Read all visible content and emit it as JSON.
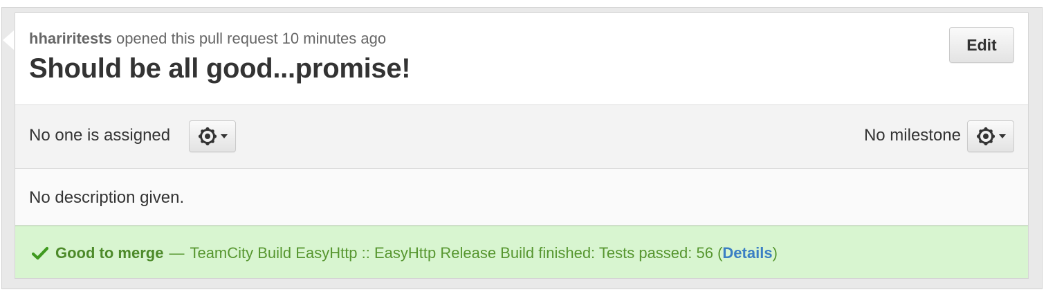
{
  "pull_request": {
    "author": "hhariritests",
    "opened_text": "opened this pull request 10 minutes ago",
    "title": "Should be all good...promise!",
    "edit_label": "Edit"
  },
  "assignment": {
    "assignee_text": "No one is assigned",
    "milestone_text": "No milestone",
    "gear_icon": "gear-icon",
    "caret_icon": "caret-down-icon"
  },
  "description": {
    "text": "No description given."
  },
  "merge_status": {
    "status_label": "Good to merge",
    "dash": "—",
    "build_text": "TeamCity Build EasyHttp :: EasyHttp Release Build finished: Tests passed: 56 (",
    "details_label": "Details",
    "close_paren": ")",
    "icon": "check-icon",
    "colors": {
      "background": "#d8f5d0",
      "text": "#56962f",
      "link": "#3b7fc4"
    }
  }
}
